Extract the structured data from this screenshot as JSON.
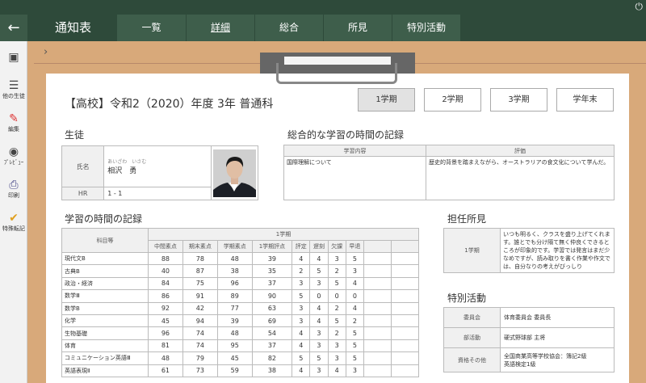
{
  "header": {
    "app_title": "通知表",
    "back_icon": "arrow-left-icon",
    "power_icon": "power-icon",
    "tabs": [
      {
        "label": "一覧",
        "active": false
      },
      {
        "label": "詳細",
        "active": true
      },
      {
        "label": "総合",
        "active": false
      },
      {
        "label": "所見",
        "active": false
      },
      {
        "label": "特別活動",
        "active": false
      }
    ]
  },
  "sidebar": {
    "items": [
      {
        "icon": "id-card-icon",
        "label": ""
      },
      {
        "icon": "list-icon",
        "label": "他の生徒"
      },
      {
        "icon": "pencil-icon",
        "label": "編集"
      },
      {
        "icon": "eye-icon",
        "label": "ﾌﾟﾚﾋﾞｭｰ"
      },
      {
        "icon": "printer-icon",
        "label": "印刷"
      },
      {
        "icon": "double-check-icon",
        "label": "特殊転記"
      }
    ]
  },
  "breadcrumb": "›",
  "document": {
    "title": "【高校】令和2（2020）年度 3年 普通科",
    "terms": [
      {
        "label": "1学期",
        "active": true
      },
      {
        "label": "2学期",
        "active": false
      },
      {
        "label": "3学期",
        "active": false
      },
      {
        "label": "学年末",
        "active": false
      }
    ]
  },
  "student": {
    "heading": "生徒",
    "name_label": "氏名",
    "name_kana": "あいざわ　いさむ",
    "name": "相沢　勇",
    "hr_label": "HR",
    "hr_value": "1 - 1"
  },
  "integrated": {
    "heading": "総合的な学習の時間の記録",
    "col_content": "学習内容",
    "col_eval": "評価",
    "content": "国際理解について",
    "evaluation": "歴史的背景を踏まえながら、オーストラリアの食文化について学んだ。"
  },
  "grades": {
    "heading": "学習の時間の記録",
    "subject_header": "科目等",
    "term_header": "1学期",
    "columns": [
      "中間素点",
      "期末素点",
      "学期素点",
      "1学期評点",
      "評定",
      "遅刻",
      "欠課",
      "早退"
    ],
    "rows": [
      {
        "subject": "現代文B",
        "values": [
          "88",
          "78",
          "48",
          "39",
          "4",
          "4",
          "3",
          "5"
        ]
      },
      {
        "subject": "古典B",
        "values": [
          "40",
          "87",
          "38",
          "35",
          "2",
          "5",
          "2",
          "3"
        ]
      },
      {
        "subject": "政治・経済",
        "values": [
          "84",
          "75",
          "96",
          "37",
          "3",
          "3",
          "5",
          "4"
        ]
      },
      {
        "subject": "数学Ⅲ",
        "values": [
          "86",
          "91",
          "89",
          "90",
          "5",
          "0",
          "0",
          "0"
        ]
      },
      {
        "subject": "数学B",
        "values": [
          "92",
          "42",
          "77",
          "63",
          "3",
          "4",
          "2",
          "4"
        ]
      },
      {
        "subject": "化学",
        "values": [
          "45",
          "94",
          "39",
          "69",
          "3",
          "4",
          "5",
          "2"
        ]
      },
      {
        "subject": "生物基礎",
        "values": [
          "96",
          "74",
          "48",
          "54",
          "4",
          "3",
          "2",
          "5"
        ]
      },
      {
        "subject": "体育",
        "values": [
          "81",
          "74",
          "95",
          "37",
          "4",
          "3",
          "3",
          "5"
        ]
      },
      {
        "subject": "コミュニケーション英語Ⅲ",
        "values": [
          "48",
          "79",
          "45",
          "82",
          "5",
          "5",
          "3",
          "5"
        ]
      },
      {
        "subject": "英語表現Ⅱ",
        "values": [
          "61",
          "73",
          "59",
          "38",
          "4",
          "3",
          "4",
          "3"
        ]
      }
    ]
  },
  "teacher": {
    "heading": "担任所見",
    "term_label": "1学期",
    "comment": "いつも明るく、クラスを盛り上げてくれます。誰とでも分け隔て無く仲良くできるところが印象的です。学習では発言はまだ少なめですが、読み取りを書く作業や作文では、自分なりの考えがびっしり"
  },
  "activities": {
    "heading": "特別活動",
    "rows": [
      {
        "label": "委員会",
        "value": "体育委員会 委員長"
      },
      {
        "label": "部活動",
        "value": "硬式野球部 主将"
      },
      {
        "label": "資格その他",
        "value": "全国商業高等学校協会：簿記2級\n英語検定1級"
      }
    ]
  }
}
